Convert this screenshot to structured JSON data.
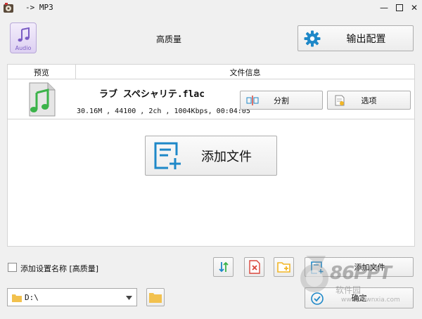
{
  "window": {
    "title": "-> MP3"
  },
  "header": {
    "format_icon_label": "Audio",
    "quality_label": "高质量",
    "output_config_label": "输出配置"
  },
  "table": {
    "columns": [
      "预览",
      "文件信息"
    ],
    "rows": [
      {
        "file_name": "ラブ スペシャリテ.flac",
        "details": "30.16M , 44100 , 2ch , 1004Kbps, 00:04:05",
        "split_label": "分割",
        "options_label": "选项"
      }
    ],
    "add_file_big_label": "添加文件"
  },
  "footer": {
    "save_setting_label": "添加设置名称 [高质量]",
    "add_file_label": "添加文件",
    "drive_value": "D:\\",
    "ok_label": "确定"
  },
  "watermark": {
    "brand": "86PPT",
    "sub": "软件园",
    "url": "www.downxia.com"
  },
  "colors": {
    "accent_blue": "#1e88c8",
    "music_green": "#3bb34a",
    "clear_red": "#d9453a",
    "folder_yellow": "#f2b627",
    "audio_purple": "#7a5cc4"
  }
}
